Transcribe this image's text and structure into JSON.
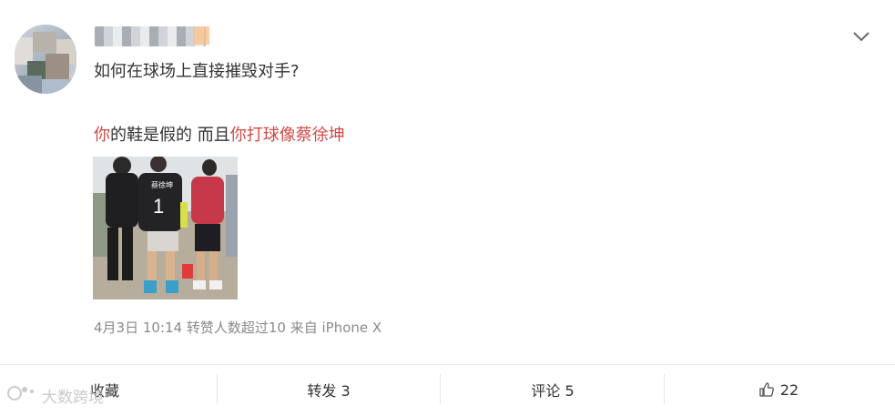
{
  "post": {
    "question": "如何在球场上直接摧毁对手?",
    "answer": {
      "part1_red": "你",
      "part2": "的鞋是假的 而且",
      "part3_red": "你打球像蔡徐坤"
    },
    "photo_jersey_text": "蔡徐坤",
    "photo_jersey_number": "1",
    "meta": "4月3日 10:14 转赞人数超过10 来自 iPhone X"
  },
  "actions": {
    "favorite_label": "收藏",
    "repost_label": "转发 3",
    "comment_label": "评论 5",
    "like_count": "22"
  },
  "watermark": {
    "text": "大数跨境"
  },
  "colors": {
    "highlight_red": "#d24a46",
    "meta_gray": "#8a8a8a"
  },
  "icons": [
    "chevron-down-icon",
    "thumbs-up-icon",
    "watermark-logo-icon"
  ]
}
